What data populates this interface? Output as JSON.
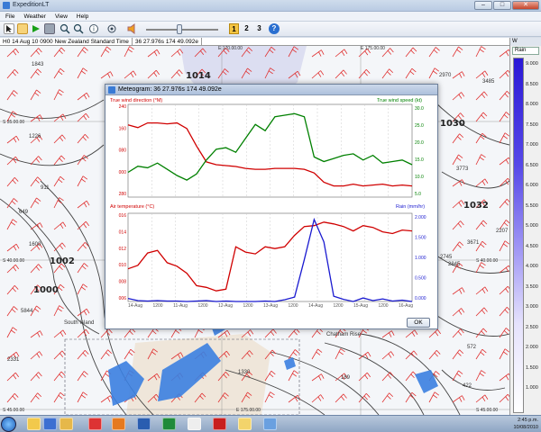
{
  "window": {
    "title": "ExpeditionLT",
    "minimize": "–",
    "maximize": "□",
    "close": "✕"
  },
  "menu": [
    "File",
    "Weather",
    "View",
    "Help"
  ],
  "toolbar": {
    "icons": [
      "arrow-pointer-icon",
      "hand-icon",
      "play-icon",
      "camera-icon",
      "zoom-in-icon",
      "zoom-out-icon",
      "info-icon",
      "target-icon",
      "speaker-icon",
      "help-icon"
    ],
    "layers": [
      "1",
      "2",
      "3"
    ]
  },
  "statusline": {
    "time": "H0 14 Aug 10 0900 New Zealand Standard Time",
    "position": "36 27.976s 174 49.092e"
  },
  "map": {
    "isobars": [
      "1014",
      "1030",
      "1032",
      "1002",
      "1000"
    ],
    "places": [
      "South Island",
      "Chatham Rise"
    ],
    "grid": [
      "S 35.00.00",
      "S 40.00.00",
      "S 45.00.00",
      "E 170.00.00",
      "E 175.00.00",
      "E 175.00.00",
      "S 40.00.00",
      "S 45.00.00"
    ],
    "numbers": [
      "1843",
      "1226",
      "911",
      "649",
      "1600",
      "5844",
      "2331",
      "2970",
      "3485",
      "3773",
      "2745",
      "2845",
      "3671",
      "2207",
      "572",
      "422",
      "189",
      "1330"
    ]
  },
  "right_panel": {
    "header": "W",
    "selected_layer": "Rain",
    "scale": [
      "9.000",
      "8.500",
      "8.000",
      "7.500",
      "7.000",
      "6.500",
      "6.000",
      "5.500",
      "5.000",
      "4.500",
      "4.000",
      "3.500",
      "3.000",
      "2.500",
      "2.000",
      "1.500",
      "1.000"
    ]
  },
  "dialog": {
    "title": "Meteogram: 36 27.976s 174 49.092e",
    "ok_label": "OK",
    "top_left_label": "True wind direction (°M)",
    "top_right_label": "True wind speed (kt)",
    "bottom_left_label": "Air temperature (°C)",
    "bottom_right_label": "Rain (mm/hr)",
    "top_left_ticks": [
      "240",
      "160",
      "080",
      "000",
      "280"
    ],
    "top_right_ticks": [
      "30.0",
      "25.0",
      "20.0",
      "15.0",
      "10.0",
      "5.0"
    ],
    "bottom_left_ticks": [
      "016",
      "014",
      "012",
      "010",
      "008",
      "006"
    ],
    "bottom_right_ticks": [
      "2.000",
      "1.500",
      "1.000",
      "0.500",
      "0.000"
    ],
    "x_ticks": [
      "14-Aug",
      "1200",
      "11-Aug",
      "1200",
      "12-Aug",
      "1200",
      "13-Aug",
      "1200",
      "14-Aug",
      "1200",
      "15-Aug",
      "1200",
      "16-Aug"
    ]
  },
  "chart_data": [
    {
      "type": "line",
      "title": "",
      "xlabel": "",
      "ylabel": "True wind direction (°M)",
      "y2label": "True wind speed (kt)",
      "ylim": [
        0,
        1
      ],
      "y2lim": [
        0,
        30
      ],
      "series": [
        {
          "name": "True wind direction (°M)",
          "color": "#d00000",
          "axis": "left",
          "values": [
            0.78,
            0.75,
            0.8,
            0.8,
            0.79,
            0.8,
            0.74,
            0.55,
            0.38,
            0.35,
            0.34,
            0.33,
            0.31,
            0.3,
            0.3,
            0.31,
            0.31,
            0.31,
            0.3,
            0.26,
            0.16,
            0.12,
            0.12,
            0.14,
            0.12,
            0.13,
            0.14,
            0.12,
            0.13,
            0.12
          ]
        },
        {
          "name": "True wind speed (kt)",
          "color": "#008000",
          "axis": "right",
          "values": [
            8.0,
            10.0,
            9.5,
            11.0,
            9.0,
            7.0,
            5.5,
            7.5,
            12.0,
            15.5,
            16.0,
            14.5,
            19.0,
            23.5,
            21.5,
            26.0,
            26.5,
            27.0,
            26.0,
            13.0,
            11.5,
            12.5,
            13.5,
            14.0,
            12.0,
            13.5,
            11.0,
            11.5,
            12.0,
            10.5
          ]
        }
      ]
    },
    {
      "type": "line",
      "title": "",
      "xlabel": "",
      "ylabel": "Air temperature (°C)",
      "y2label": "Rain (mm/hr)",
      "ylim": [
        0,
        1
      ],
      "y2lim": [
        0,
        2
      ],
      "series": [
        {
          "name": "Air temperature (°C)",
          "color": "#d00000",
          "axis": "left",
          "values": [
            0.37,
            0.41,
            0.55,
            0.58,
            0.44,
            0.4,
            0.32,
            0.18,
            0.16,
            0.12,
            0.14,
            0.62,
            0.56,
            0.54,
            0.62,
            0.6,
            0.62,
            0.75,
            0.85,
            0.86,
            0.9,
            0.88,
            0.85,
            0.8,
            0.86,
            0.84,
            0.79,
            0.77,
            0.81,
            0.8
          ]
        },
        {
          "name": "Rain (mm/hr)",
          "color": "#1a1ad0",
          "axis": "right",
          "values": [
            0.07,
            0.02,
            0.01,
            0.02,
            0.01,
            0.01,
            0.0,
            0.01,
            0.02,
            0.0,
            0.01,
            0.0,
            0.0,
            0.0,
            0.01,
            0.0,
            0.04,
            0.1,
            0.95,
            1.86,
            1.35,
            0.12,
            0.05,
            0.0,
            0.08,
            0.02,
            0.06,
            0.01,
            0.03,
            0.0
          ]
        }
      ]
    }
  ],
  "taskbar": {
    "apps": [
      "windows-explorer-icon",
      "media-player-icon",
      "folder-icon",
      "chrome-icon",
      "firefox-icon",
      "word-icon",
      "excel-icon",
      "notepad-icon",
      "pdf-icon",
      "sticky-notes-icon",
      "expedition-icon"
    ],
    "time": "2:45 p.m.",
    "date": "10/08/2010"
  }
}
